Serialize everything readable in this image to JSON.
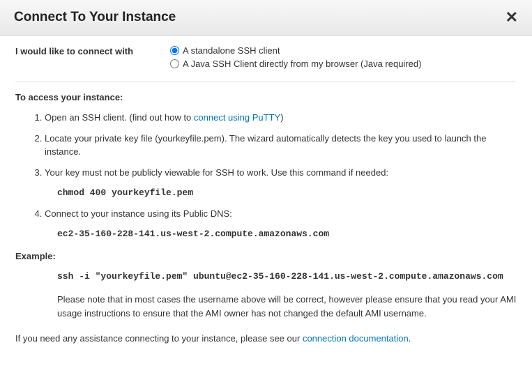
{
  "header": {
    "title": "Connect To Your Instance",
    "close": "✕"
  },
  "connect": {
    "label": "I would like to connect with",
    "option1": "A standalone SSH client",
    "option2": "A Java SSH Client directly from my browser (Java required)"
  },
  "access": {
    "heading": "To access your instance:",
    "step1_prefix": "Open an SSH client. (find out how to ",
    "step1_link": "connect using PuTTY",
    "step1_suffix": ")",
    "step2": "Locate your private key file (yourkeyfile.pem). The wizard automatically detects the key you used to launch the instance.",
    "step3": "Your key must not be publicly viewable for SSH to work. Use this command if needed:",
    "step3_code": "chmod 400 yourkeyfile.pem",
    "step4": "Connect to your instance using its Public DNS:",
    "step4_code": "ec2-35-160-228-141.us-west-2.compute.amazonaws.com"
  },
  "example": {
    "heading": "Example:",
    "code": "ssh -i \"yourkeyfile.pem\" ubuntu@ec2-35-160-228-141.us-west-2.compute.amazonaws.com",
    "note": "Please note that in most cases the username above will be correct, however please ensure that you read your AMI usage instructions to ensure that the AMI owner has not changed the default AMI username."
  },
  "footer": {
    "prefix": "If you need any assistance connecting to your instance, please see our ",
    "link": "connection documentation",
    "suffix": "."
  }
}
